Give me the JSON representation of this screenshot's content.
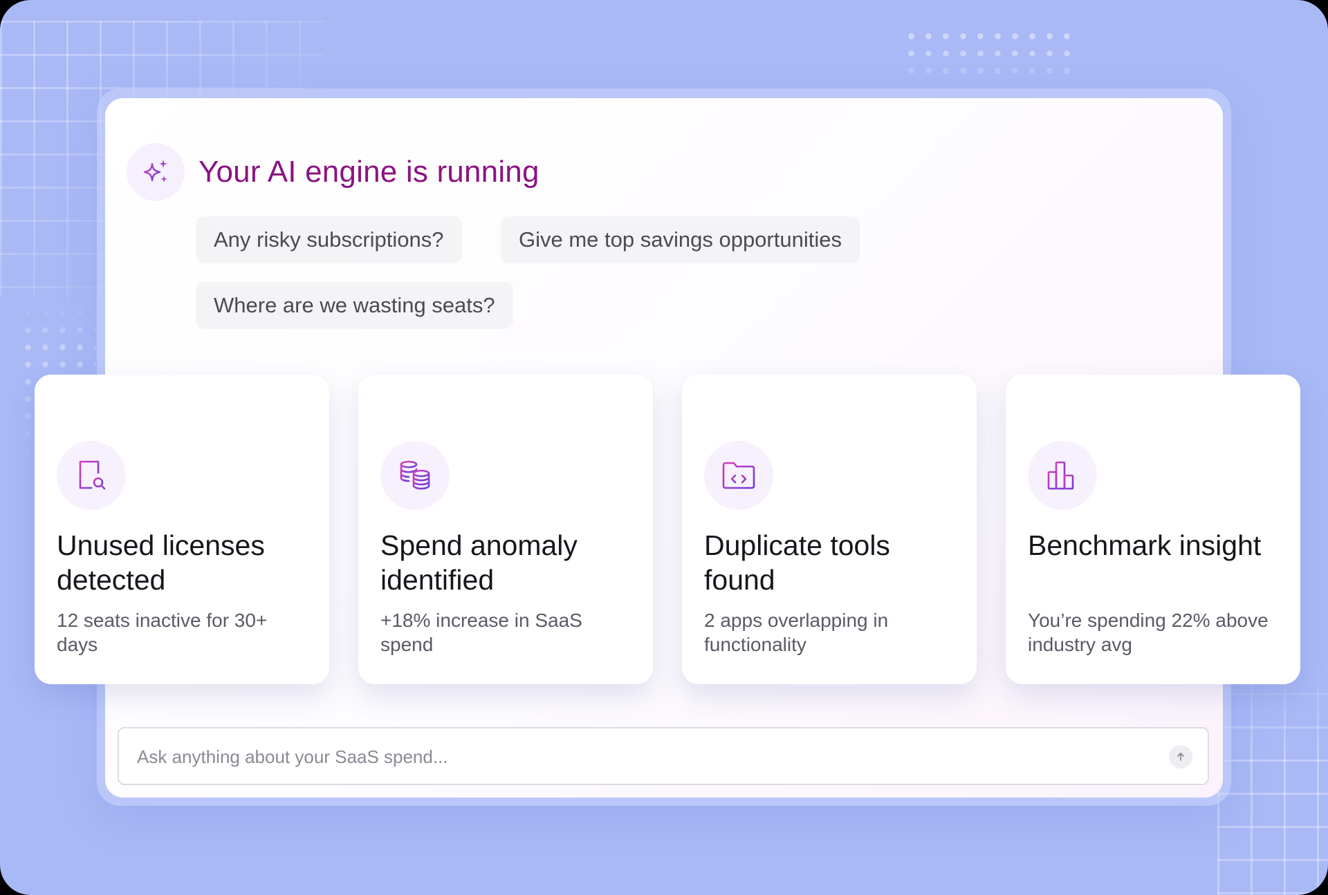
{
  "assistant": {
    "title": "Your AI engine is running",
    "icon": "sparkles-icon"
  },
  "suggestions": [
    "Any risky subscriptions?",
    "Give me top savings opportunities",
    "Where are we wasting seats?"
  ],
  "insight_cards": [
    {
      "icon": "report-search-icon",
      "title": "Unused licenses detected",
      "description": "12 seats inactive for 30+ days"
    },
    {
      "icon": "coins-stack-icon",
      "title": "Spend anomaly identified",
      "description": "+18% increase in SaaS spend"
    },
    {
      "icon": "code-folder-icon",
      "title": "Duplicate tools found",
      "description": "2 apps overlapping in functionality"
    },
    {
      "icon": "bar-chart-icon",
      "title": "Benchmark insight",
      "description": "You’re spending 22% above industry avg"
    }
  ],
  "ask_box": {
    "placeholder": "Ask anything about your SaaS spend...",
    "send_icon": "arrow-up-icon"
  },
  "colors": {
    "background": "#a9b9f6",
    "title": "#8a1481",
    "icon_gradient_start": "#d43fb2",
    "icon_gradient_end": "#6b3ce0"
  }
}
